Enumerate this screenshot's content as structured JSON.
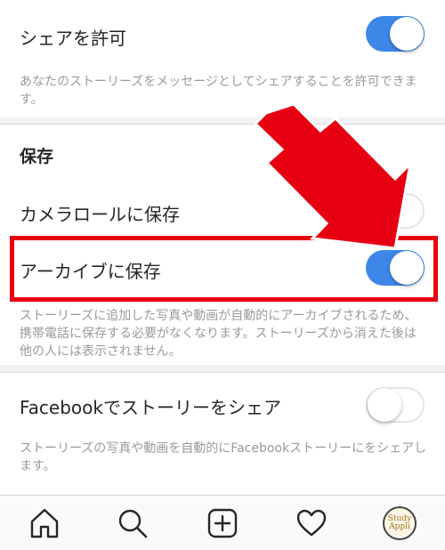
{
  "settings": {
    "share_allow": {
      "label": "シェアを許可",
      "enabled": true,
      "description": "あなたのストーリーズをメッセージとしてシェアすることを許可できます。"
    },
    "save_section": {
      "title": "保存",
      "camera_roll": {
        "label": "カメラロールに保存",
        "enabled": false
      },
      "archive": {
        "label": "アーカイブに保存",
        "enabled": true
      },
      "archive_description": "ストーリーズに追加した写真や動画が自動的にアーカイブされるため、携帯電話に保存する必要がなくなります。ストーリーズから消えた後は他の人には表示されません。"
    },
    "facebook_share": {
      "label": "Facebookでストーリーをシェア",
      "enabled": false,
      "description": "ストーリーズの写真や動画を自動的にFacebookストーリーにをシェアします。"
    }
  },
  "annotation": {
    "arrow_color": "#e60012",
    "box_color": "#e60012"
  },
  "tabbar": {
    "icons": [
      "home-icon",
      "search-icon",
      "add-post-icon",
      "heart-icon",
      "profile-avatar"
    ],
    "avatar": {
      "line1": "Study",
      "line2": "Appli"
    }
  },
  "colors": {
    "toggle_on": "#3d87e8",
    "description_text": "#9a9a9a"
  }
}
